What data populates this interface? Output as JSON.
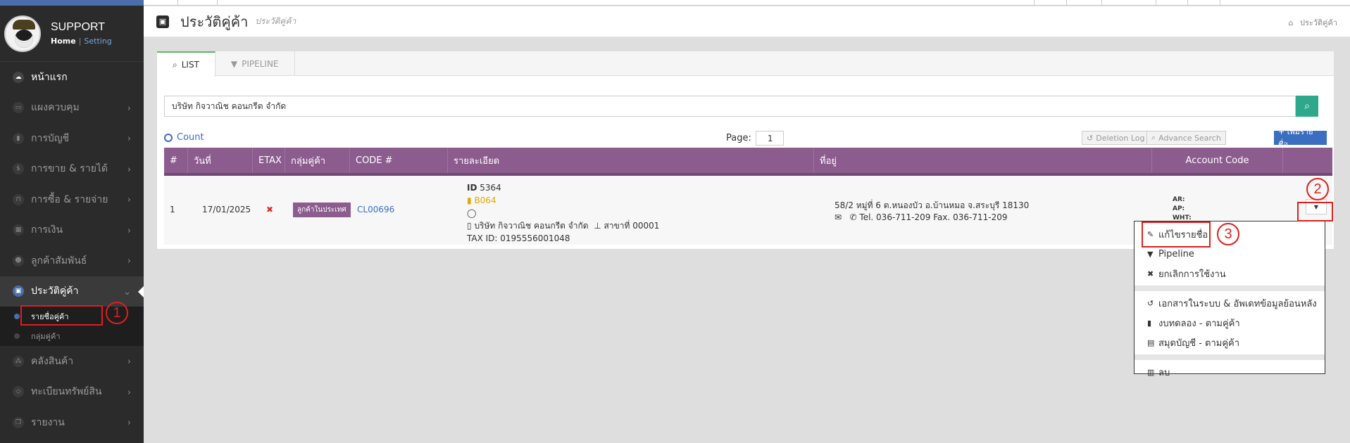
{
  "sidebar": {
    "brand_title": "SUPPORT",
    "home_link": "Home",
    "separator": "|",
    "setting_link": "Setting",
    "items": [
      {
        "label": "หน้าแรก",
        "icon": "cloud-icon"
      },
      {
        "label": "แผงควบคุม",
        "icon": "monitor-icon"
      },
      {
        "label": "การบัญชี",
        "icon": "book-icon"
      },
      {
        "label": "การขาย & รายได้",
        "icon": "dollar-icon"
      },
      {
        "label": "การซื้อ & รายจ่าย",
        "icon": "cart-icon"
      },
      {
        "label": "การเงิน",
        "icon": "calendar-icon"
      },
      {
        "label": "ลูกค้าสัมพันธ์",
        "icon": "users-icon"
      },
      {
        "label": "ประวัติคู่ค้า",
        "icon": "address-book-icon"
      },
      {
        "label": "คลังสินค้า",
        "icon": "cubes-icon"
      },
      {
        "label": "ทะเบียนทรัพย์สิน",
        "icon": "diamond-icon"
      },
      {
        "label": "รายงาน",
        "icon": "copy-icon"
      }
    ],
    "sub_items": [
      {
        "label": "รายชื่อคู่ค้า"
      },
      {
        "label": "กลุ่มคู่ค้า"
      }
    ]
  },
  "header": {
    "title": "ประวัติคู่ค้า",
    "subtitle": "ประวัติคู่ค้า",
    "breadcrumb": "ประวัติคู่ค้า"
  },
  "tabs": [
    {
      "label": "LIST"
    },
    {
      "label": "PIPELINE"
    }
  ],
  "search": {
    "value": "บริษัท กิจวาณิช คอนกรีต จำกัด"
  },
  "controls": {
    "count_label": "Count",
    "page_label": "Page:",
    "page_value": "1",
    "deletion_log": "Deletion Log",
    "advance_search": "Advance Search",
    "add_button": "+ เพิ่มรายชื่อ"
  },
  "table": {
    "columns": [
      "#",
      "วันที่",
      "ETAX",
      "กลุ่มคู่ค้า",
      "CODE #",
      "รายละเอียด",
      "ที่อยู่",
      "Account Code"
    ],
    "rows": [
      {
        "num": "1",
        "date": "17/01/2025",
        "etax": "✖",
        "group": "ลูกค้าในประเทศ",
        "code": "CL00696",
        "detail_id_label": "ID",
        "detail_id": "5364",
        "detail_ref": "B064",
        "detail_name": "บริษัท กิจวาณิช คอนกรีต จำกัด",
        "detail_branch": "สาขาที่ 00001",
        "detail_tax": "TAX ID: 0195556001048",
        "address": "58/2 หมู่ที่ 6 ต.หนองบัว อ.บ้านหมอ จ.สระบุรี 18130",
        "phone": "Tel. 036-711-209 Fax. 036-711-209",
        "ar": "AR:",
        "ap": "AP:",
        "wht": "WHT:"
      }
    ]
  },
  "dropdown": {
    "items": [
      {
        "label": "แก้ไขรายชื่อ",
        "icon": "edit-icon"
      },
      {
        "label": "Pipeline",
        "icon": "filter-icon"
      },
      {
        "label": "ยกเลิกการใช้งาน",
        "icon": "close-icon"
      },
      {
        "label": "เอกสารในระบบ & อัพเดทข้อมูลย้อนหลัง",
        "icon": "history-icon"
      },
      {
        "label": "งบทดลอง - ตามคู่ค้า",
        "icon": "book-icon"
      },
      {
        "label": "สมุดบัญชี - ตามคู่ค้า",
        "icon": "file-icon"
      },
      {
        "label": "ลบ",
        "icon": "trash-icon"
      }
    ]
  },
  "annotations": [
    "1",
    "2",
    "3"
  ],
  "colors": {
    "sidebar_bg": "#2b2b2b",
    "accent_blue": "#4a6ea9",
    "table_header": "#8c5c8f",
    "search_button": "#2ea88a",
    "annotation_red": "#e01e1e"
  }
}
